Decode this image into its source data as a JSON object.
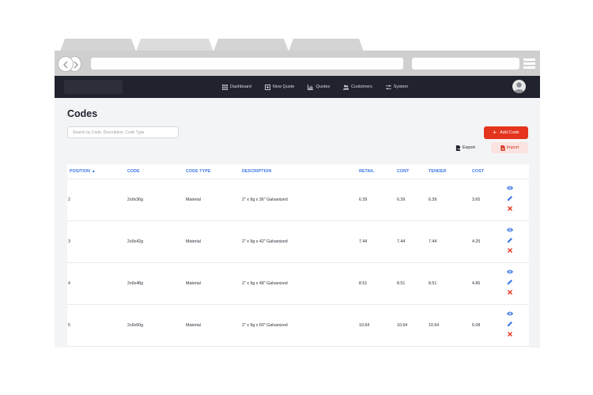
{
  "colors": {
    "accent": "#3b76e6",
    "danger": "#e4341d",
    "nav_bg": "#20232e"
  },
  "nav": {
    "items": [
      {
        "label": "Dashboard",
        "icon": "grid-icon"
      },
      {
        "label": "New Quote",
        "icon": "plus-square-icon"
      },
      {
        "label": "Quotes",
        "icon": "bar-chart-icon"
      },
      {
        "label": "Customers",
        "icon": "users-icon"
      },
      {
        "label": "System",
        "icon": "sliders-icon"
      }
    ]
  },
  "page": {
    "title": "Codes",
    "search_placeholder": "Search by Code, Description, Code Type",
    "add_label": "Add Code",
    "export_label": "Export",
    "import_label": "Import"
  },
  "table": {
    "headers": {
      "position": "POSITION ▲",
      "code": "CODE",
      "code_type": "CODE TYPE",
      "description": "DESCRIPTION",
      "retail": "RETAIL",
      "cont": "CONT",
      "tender": "TENDER",
      "cost": "COST"
    },
    "rows": [
      {
        "position": "2",
        "code": "2x9x36g",
        "code_type": "Material",
        "description": "2\" x 9g x 36\" Galvanized",
        "retail": "6.39",
        "cont": "6.39",
        "tender": "6.39",
        "cost": "3.65"
      },
      {
        "position": "3",
        "code": "2x9x42g",
        "code_type": "Material",
        "description": "2\" x 9g x 42\" Galvanized",
        "retail": "7.44",
        "cont": "7.44",
        "tender": "7.44",
        "cost": "4.25"
      },
      {
        "position": "4",
        "code": "2x9x48g",
        "code_type": "Material",
        "description": "2\" x 9g x 48\" Galvanized",
        "retail": "8.51",
        "cont": "8.51",
        "tender": "8.51",
        "cost": "4.86"
      },
      {
        "position": "5",
        "code": "2x9x60g",
        "code_type": "Material",
        "description": "2\" x 9g x 60\" Galvanized",
        "retail": "10.64",
        "cont": "10.64",
        "tender": "10.64",
        "cost": "6.08"
      }
    ]
  }
}
